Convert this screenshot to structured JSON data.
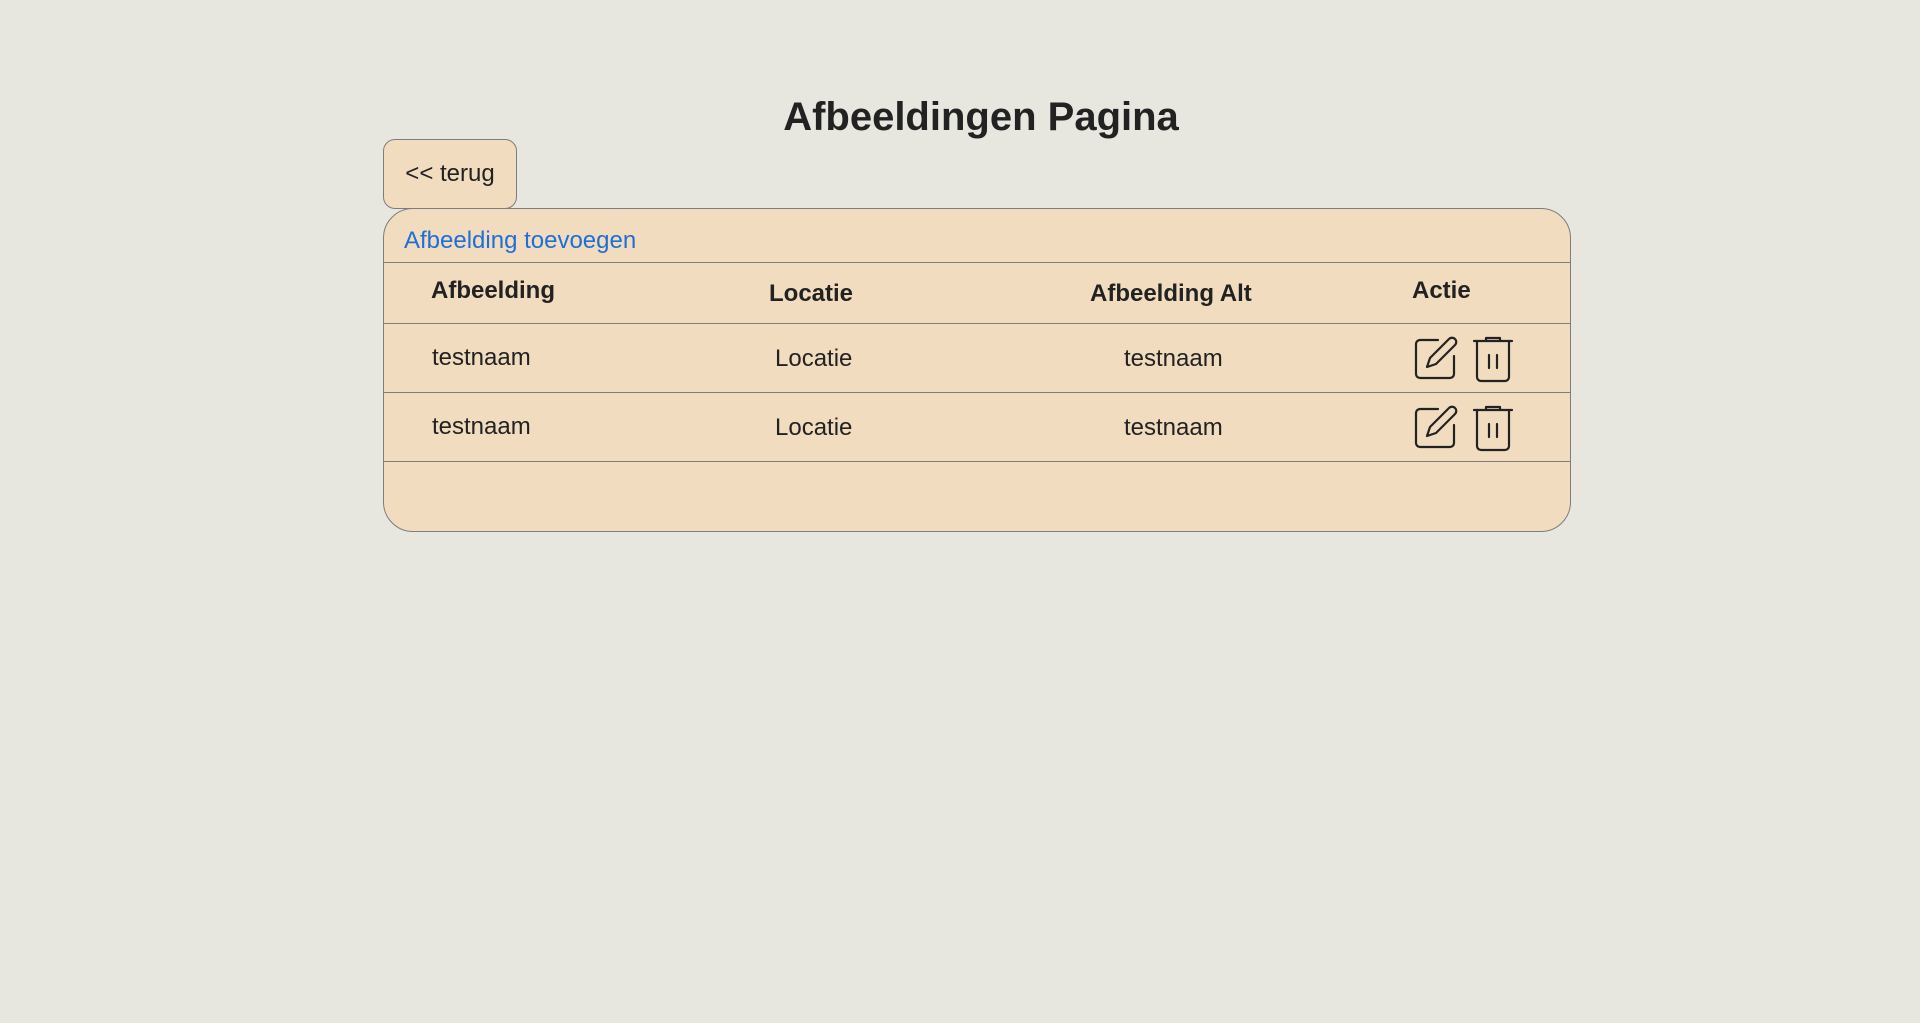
{
  "page": {
    "title": "Afbeeldingen Pagina"
  },
  "back_button": {
    "label": "<< terug"
  },
  "panel": {
    "add_link": "Afbeelding toevoegen"
  },
  "table": {
    "headers": [
      "Afbeelding",
      "Locatie",
      "Afbeelding Alt",
      "Actie"
    ],
    "rows": [
      {
        "afbeelding": "testnaam",
        "locatie": "Locatie",
        "alt": "testnaam",
        "actions": [
          "edit-icon",
          "trash-icon"
        ]
      },
      {
        "afbeelding": "testnaam",
        "locatie": "Locatie",
        "alt": "testnaam",
        "actions": [
          "edit-icon",
          "trash-icon"
        ]
      }
    ]
  },
  "colors": {
    "background": "#e7e6df",
    "panel": "#f2dcbf",
    "link": "#1f6fd6",
    "border": "#7d7d7d",
    "text": "#222222"
  }
}
